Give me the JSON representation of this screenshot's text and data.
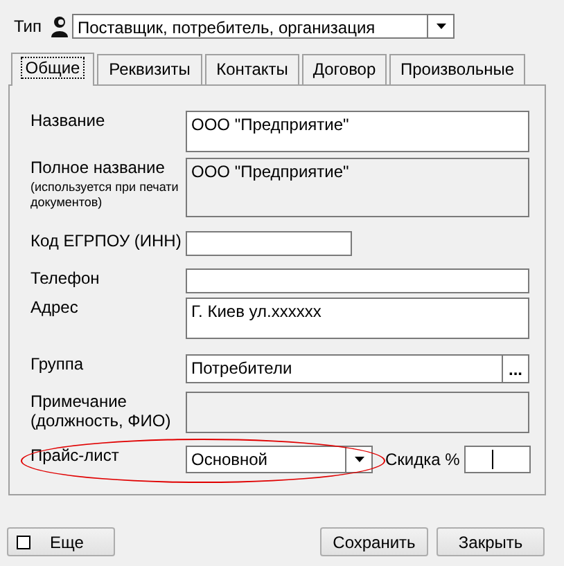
{
  "type_field": {
    "label": "Тип",
    "value": "Поставщик, потребитель, организация"
  },
  "tabs": [
    {
      "label": "Общие",
      "selected": true
    },
    {
      "label": "Реквизиты",
      "selected": false
    },
    {
      "label": "Контакты",
      "selected": false
    },
    {
      "label": "Договор",
      "selected": false
    },
    {
      "label": "Произвольные",
      "selected": false
    }
  ],
  "fields": [
    {
      "kind": "multiline",
      "label": "Название",
      "value": "ООО \"Предприятие\"",
      "disabled": false
    },
    {
      "kind": "multiline",
      "label": "Полное название",
      "note": "(используется при печати документов)",
      "value": "ООО \"Предприятие\"",
      "disabled": true
    },
    {
      "kind": "short",
      "label": "Код ЕГРПОУ (ИНН)",
      "disabled": false
    },
    {
      "kind": "text",
      "label": "Телефон",
      "disabled": false
    },
    {
      "kind": "multiline",
      "label": "Адрес",
      "value": "Г. Киев ул.хххххх",
      "disabled": false
    },
    {
      "kind": "lookup",
      "label": "Группа",
      "value": "Потребители",
      "button": "..."
    },
    {
      "kind": "multiline",
      "label": "Примечание (должность, ФИО)",
      "disabled": true
    },
    {
      "kind": "combo",
      "label": "Прайс-лист",
      "value": "Основной",
      "highlighted": true
    }
  ],
  "discount_field": {
    "label": "Скидка %",
    "focused": true
  },
  "more_button": {
    "label": "Еще",
    "checked": false
  },
  "buttons": [
    "Сохранить",
    "Закрыть"
  ]
}
